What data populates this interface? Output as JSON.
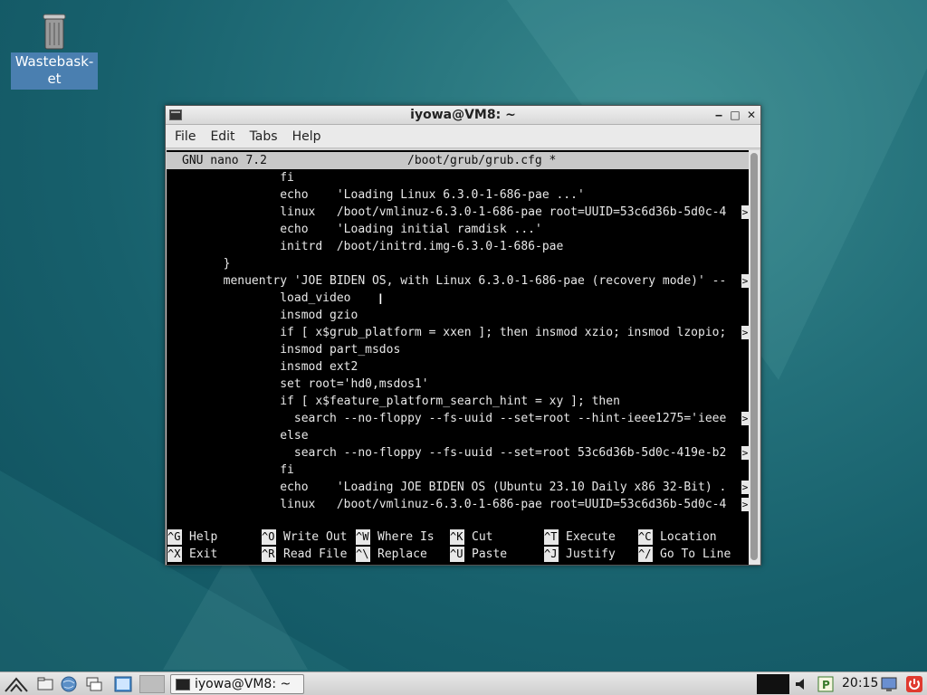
{
  "desktop": {
    "icons": [
      {
        "label": "Wastebask-\net",
        "icon": "trash-icon"
      }
    ]
  },
  "window": {
    "title": "iyowa@VM8: ~",
    "menu": [
      "File",
      "Edit",
      "Tabs",
      "Help"
    ]
  },
  "nano": {
    "version": "GNU nano 7.2",
    "filename": "/boot/grub/grub.cfg *",
    "lines": [
      "                fi",
      "                echo    'Loading Linux 6.3.0-1-686-pae ...'",
      "                linux   /boot/vmlinuz-6.3.0-1-686-pae root=UUID=53c6d36b-5d0c-4",
      "                echo    'Loading initial ramdisk ...'",
      "                initrd  /boot/initrd.img-6.3.0-1-686-pae",
      "        }",
      "        menuentry 'JOE BIDEN OS, with Linux 6.3.0-1-686-pae (recovery mode)' --",
      "                load_video",
      "                insmod gzio",
      "                if [ x$grub_platform = xxen ]; then insmod xzio; insmod lzopio;",
      "                insmod part_msdos",
      "                insmod ext2",
      "                set root='hd0,msdos1'",
      "                if [ x$feature_platform_search_hint = xy ]; then",
      "                  search --no-floppy --fs-uuid --set=root --hint-ieee1275='ieee",
      "                else",
      "                  search --no-floppy --fs-uuid --set=root 53c6d36b-5d0c-419e-b2",
      "                fi",
      "                echo    'Loading JOE BIDEN OS (Ubuntu 23.10 Daily x86 32-Bit) .",
      "                linux   /boot/vmlinuz-6.3.0-1-686-pae root=UUID=53c6d36b-5d0c-4"
    ],
    "overflow_lines": [
      2,
      6,
      9,
      14,
      16,
      18,
      19
    ],
    "shortcuts": [
      [
        {
          "key": "^G",
          "label": "Help"
        },
        {
          "key": "^O",
          "label": "Write Out"
        },
        {
          "key": "^W",
          "label": "Where Is"
        },
        {
          "key": "^K",
          "label": "Cut"
        },
        {
          "key": "^T",
          "label": "Execute"
        },
        {
          "key": "^C",
          "label": "Location"
        }
      ],
      [
        {
          "key": "^X",
          "label": "Exit"
        },
        {
          "key": "^R",
          "label": "Read File"
        },
        {
          "key": "^\\",
          "label": "Replace"
        },
        {
          "key": "^U",
          "label": "Paste"
        },
        {
          "key": "^J",
          "label": "Justify"
        },
        {
          "key": "^/",
          "label": "Go To Line"
        }
      ]
    ]
  },
  "taskbar": {
    "task_label": "iyowa@VM8: ~",
    "clock": "20:15"
  },
  "colors": {
    "terminal_bg": "#000000",
    "terminal_fg": "#e8e8e8",
    "header_bg": "#c8c8c8"
  }
}
